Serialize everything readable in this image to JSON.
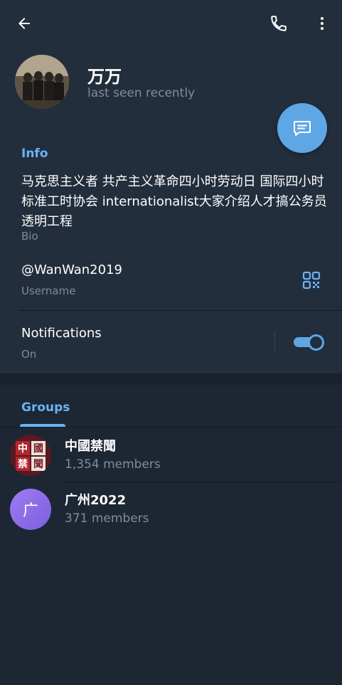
{
  "profile": {
    "name": "万万",
    "status": "last seen recently"
  },
  "info": {
    "section_title": "Info",
    "bio": "马克思主义者 共产主义革命四小时劳动日 国际四小时标准工时协会 internationalist大家介绍人才搞公务员透明工程",
    "bio_label": "Bio",
    "username": "@WanWan2019",
    "username_label": "Username",
    "notifications_title": "Notifications",
    "notifications_state": "On",
    "notifications_enabled": true
  },
  "groups": {
    "tab_label": "Groups",
    "items": [
      {
        "name": "中國禁聞",
        "members": "1,354 members",
        "avatar_chars": [
          "中",
          "國",
          "禁",
          "聞"
        ]
      },
      {
        "name": "广州2022",
        "members": "371 members",
        "avatar_letter": "广"
      }
    ]
  },
  "colors": {
    "background": "#1d2733",
    "surface": "#232e3c",
    "accent": "#6ab3f3",
    "fab": "#5fa6e4",
    "muted_text": "#7f8c99"
  },
  "icons": [
    "back-arrow-icon",
    "phone-icon",
    "more-vertical-icon",
    "message-icon",
    "qr-code-icon",
    "toggle-switch"
  ]
}
